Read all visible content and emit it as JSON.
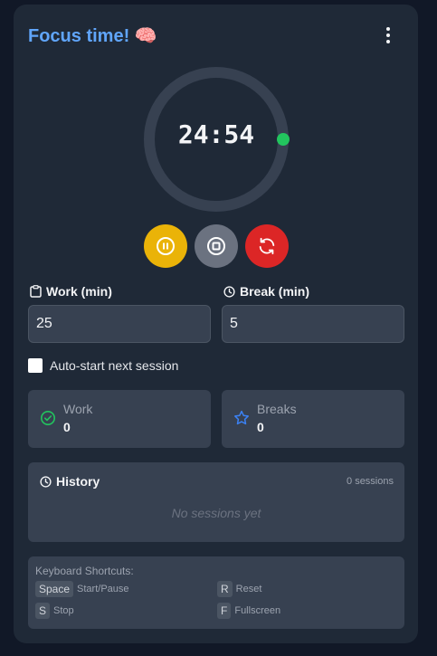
{
  "header": {
    "title": "Focus time! 🧠",
    "menu_icon": "kebab-menu-icon"
  },
  "timer": {
    "display": "24:54",
    "progress": 0.0067,
    "track_color": "#374151",
    "indicator_color": "#22c55e"
  },
  "controls": [
    {
      "name": "pause",
      "icon": "pause-icon",
      "color": "#eab308"
    },
    {
      "name": "stop",
      "icon": "stop-icon",
      "color": "#6b7280"
    },
    {
      "name": "reset",
      "icon": "reset-icon",
      "color": "#dc2626"
    }
  ],
  "settings": {
    "work_label": "Work (min)",
    "work_value": "25",
    "break_label": "Break (min)",
    "break_value": "5",
    "autostart_label": "Auto-start next session",
    "autostart_checked": false
  },
  "stats": {
    "work": {
      "label": "Work",
      "value": "0",
      "icon": "check-circle-icon"
    },
    "breaks": {
      "label": "Breaks",
      "value": "0",
      "icon": "star-icon"
    }
  },
  "history": {
    "title": "History",
    "count": "0 sessions",
    "empty": "No sessions yet"
  },
  "shortcuts": {
    "title": "Keyboard Shortcuts:",
    "items": [
      {
        "key": "Space",
        "desc": "Start/Pause"
      },
      {
        "key": "R",
        "desc": "Reset"
      },
      {
        "key": "S",
        "desc": "Stop"
      },
      {
        "key": "F",
        "desc": "Fullscreen"
      }
    ]
  },
  "colors": {
    "accent": "#60a5fa",
    "background": "#111827",
    "card": "#1f2937",
    "surface": "#374151"
  }
}
